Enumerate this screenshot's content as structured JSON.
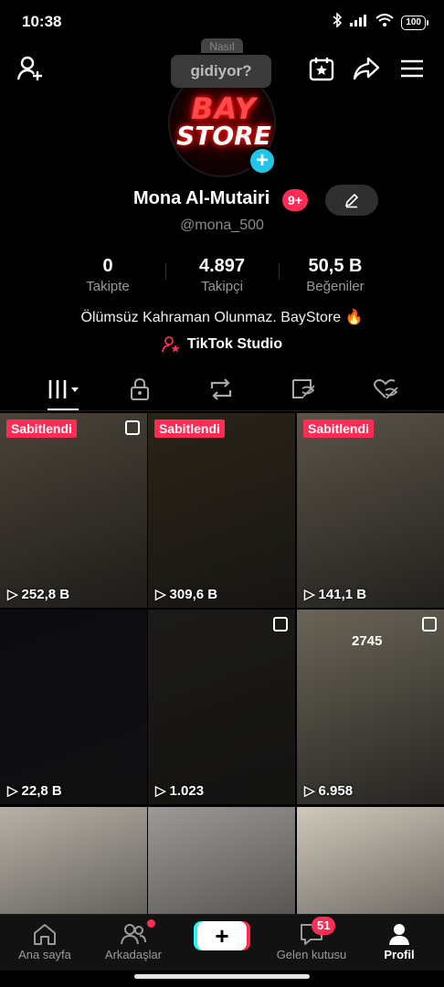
{
  "status_bar": {
    "time": "10:38",
    "battery": "100"
  },
  "tooltip": {
    "partial_top": "Nasıl",
    "text": "gidiyor?"
  },
  "avatar": {
    "line1": "BAY",
    "line2": "STORE"
  },
  "profile": {
    "name": "Mona Al-Mutairi",
    "badge": "9+",
    "username": "@mona_500",
    "bio": "Ölümsüz Kahraman Olunmaz. BayStore 🔥",
    "studio_link": "TikTok Studio"
  },
  "stats": [
    {
      "value": "0",
      "label": "Takipte"
    },
    {
      "value": "4.897",
      "label": "Takipçi"
    },
    {
      "value": "50,5 B",
      "label": "Beğeniler"
    }
  ],
  "grid": {
    "pinned_label": "Sabitlendi",
    "cells": [
      {
        "views": "252,8 B",
        "pinned": true,
        "bg": "#4a4338"
      },
      {
        "views": "309,6 B",
        "pinned": true,
        "bg": "#2a2418"
      },
      {
        "views": "141,1 B",
        "pinned": true,
        "bg": "#5a5448"
      },
      {
        "views": "22,8 B",
        "pinned": false,
        "bg": "#0c0c10"
      },
      {
        "views": "1.023",
        "pinned": false,
        "bg": "#1b1a18"
      },
      {
        "views": "6.958",
        "pinned": false,
        "bg": "#6a6558",
        "number": "2745"
      },
      {
        "views": "",
        "pinned": false,
        "bg": "#b7b2a8"
      },
      {
        "views": "",
        "pinned": false,
        "bg": "#9c9a96"
      },
      {
        "views": "",
        "pinned": false,
        "bg": "#cfc8bb"
      }
    ]
  },
  "bottom_nav": {
    "home": "Ana sayfa",
    "friends": "Arkadaşlar",
    "create": "+",
    "inbox": "Gelen kutusu",
    "inbox_count": "51",
    "profile": "Profil"
  },
  "colors": {
    "accent": "#fe2c55",
    "cyan": "#25f4ee",
    "background": "#000000"
  }
}
